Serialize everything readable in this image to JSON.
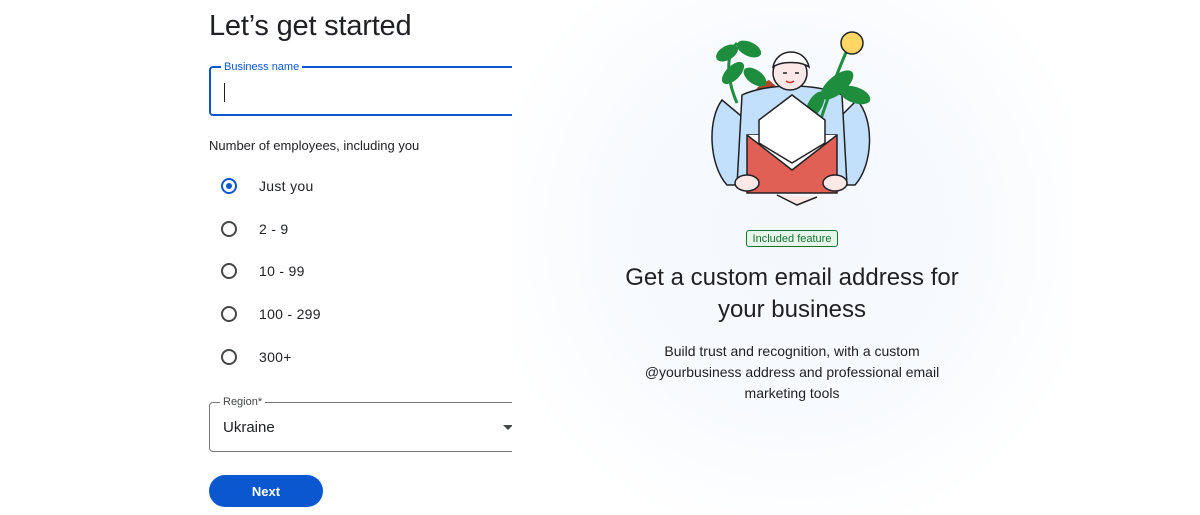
{
  "form": {
    "title": "Let’s get started",
    "business_name": {
      "label": "Business name",
      "value": "",
      "placeholder": ""
    },
    "employees": {
      "label": "Number of employees, including you",
      "options": [
        {
          "label": "Just you",
          "checked": true
        },
        {
          "label": "2 - 9",
          "checked": false
        },
        {
          "label": "10 - 99",
          "checked": false
        },
        {
          "label": "100 - 299",
          "checked": false
        },
        {
          "label": "300+",
          "checked": false
        }
      ]
    },
    "region": {
      "label": "Region*",
      "value": "Ukraine"
    },
    "next_label": "Next"
  },
  "promo": {
    "badge": "Included feature",
    "title": "Get a custom email address for your business",
    "description": "Build trust and recognition, with a custom @yourbusiness address and professional email marketing tools",
    "illustration": "person-holding-envelope-with-plants-illustration"
  },
  "colors": {
    "primary": "#0b57d0",
    "badge_green": "#137333",
    "badge_bg": "#e6f4ea",
    "envelope_red": "#e06055",
    "leaf_green": "#1e8e3e",
    "flower_yellow": "#fdd663",
    "sleeve_blue": "#c2e0fb"
  }
}
